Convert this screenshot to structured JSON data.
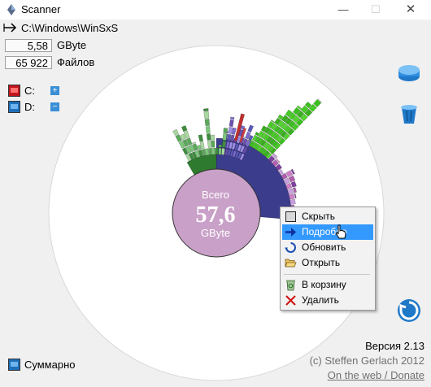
{
  "window": {
    "title": "Scanner",
    "minimize": "—",
    "maximize": "☐",
    "close": "✕"
  },
  "path": {
    "current": "C:\\Windows\\WinSxS"
  },
  "stats": {
    "size_value": "5,58",
    "size_unit": "GByte",
    "files_value": "65 922",
    "files_label": "Файлов"
  },
  "drives": [
    {
      "label": "C:"
    },
    {
      "label": "D:"
    }
  ],
  "drive_expand": {
    "plus": "+",
    "minus": "−"
  },
  "center": {
    "label_top": "Всего",
    "value": "57,6",
    "label_bottom": "GByte"
  },
  "context_menu": {
    "items": [
      {
        "label": "Скрыть",
        "icon": "hide-icon"
      },
      {
        "label": "Подробно",
        "icon": "details-arrow-icon"
      },
      {
        "label": "Обновить",
        "icon": "refresh-icon"
      },
      {
        "label": "Открыть",
        "icon": "folder-open-icon"
      },
      {
        "label": "В корзину",
        "icon": "recycle-bin-icon"
      },
      {
        "label": "Удалить",
        "icon": "delete-icon"
      }
    ]
  },
  "footer": {
    "version": "Версия 2.13",
    "copyright": "(c) Steffen Gerlach 2012",
    "link": "On the web / Donate",
    "summary": "Суммарно"
  },
  "colors": {
    "accent": "#3399ff",
    "center_fill": "#c9a0c8",
    "wedge_dark": "#3c3c8c",
    "green": "#44cc22"
  }
}
